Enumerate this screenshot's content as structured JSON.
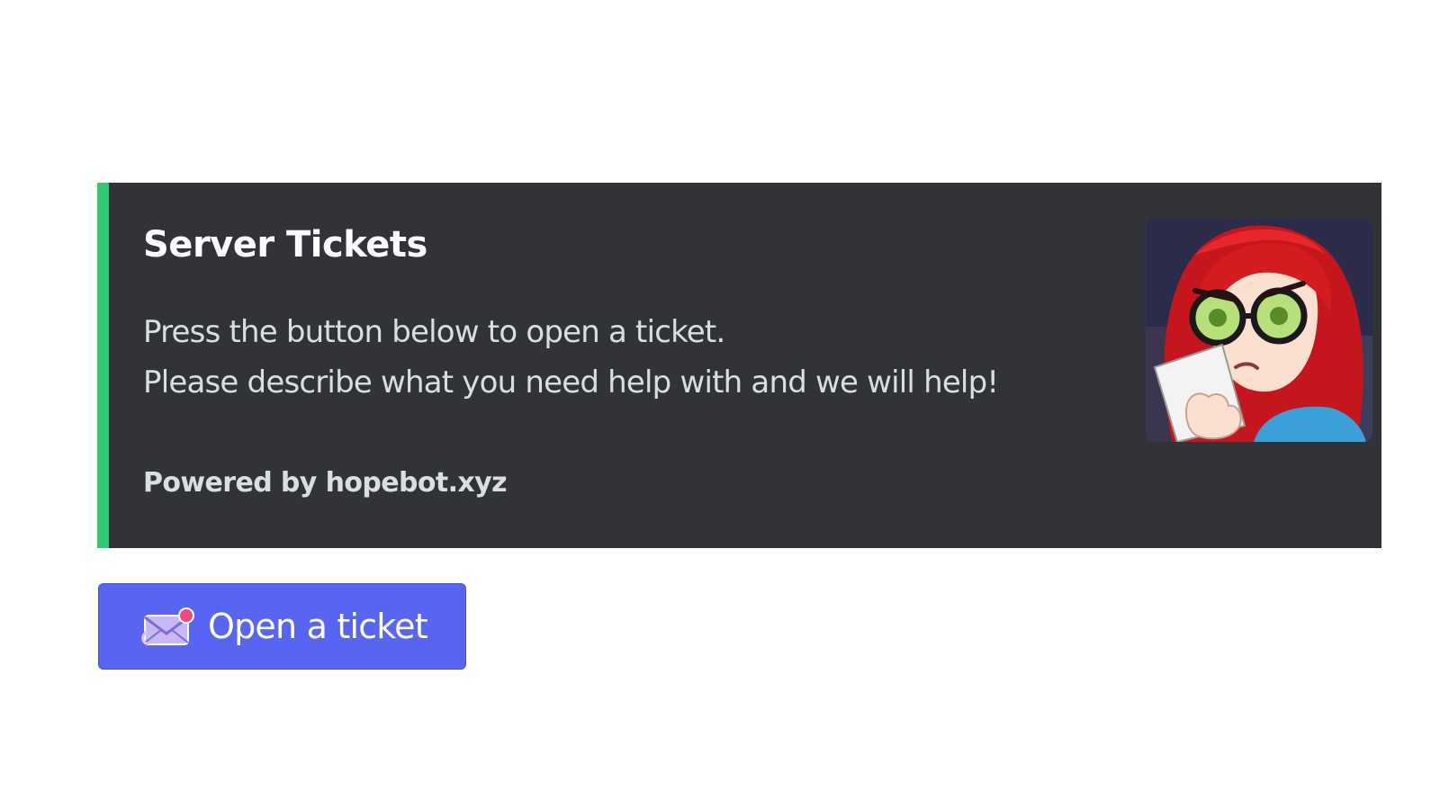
{
  "embed": {
    "title": "Server Tickets",
    "description_lines": [
      "Press the button below to open a ticket.",
      "Please describe what you need help with and we will help!"
    ],
    "footer": "Powered by hopebot.xyz",
    "accent_color": "#2ecc71",
    "background_color": "#313338",
    "thumbnail_icon": "redhead-character-avatar"
  },
  "button": {
    "label": "Open a ticket",
    "icon": "envelope-icon",
    "color": "#5865f2"
  }
}
